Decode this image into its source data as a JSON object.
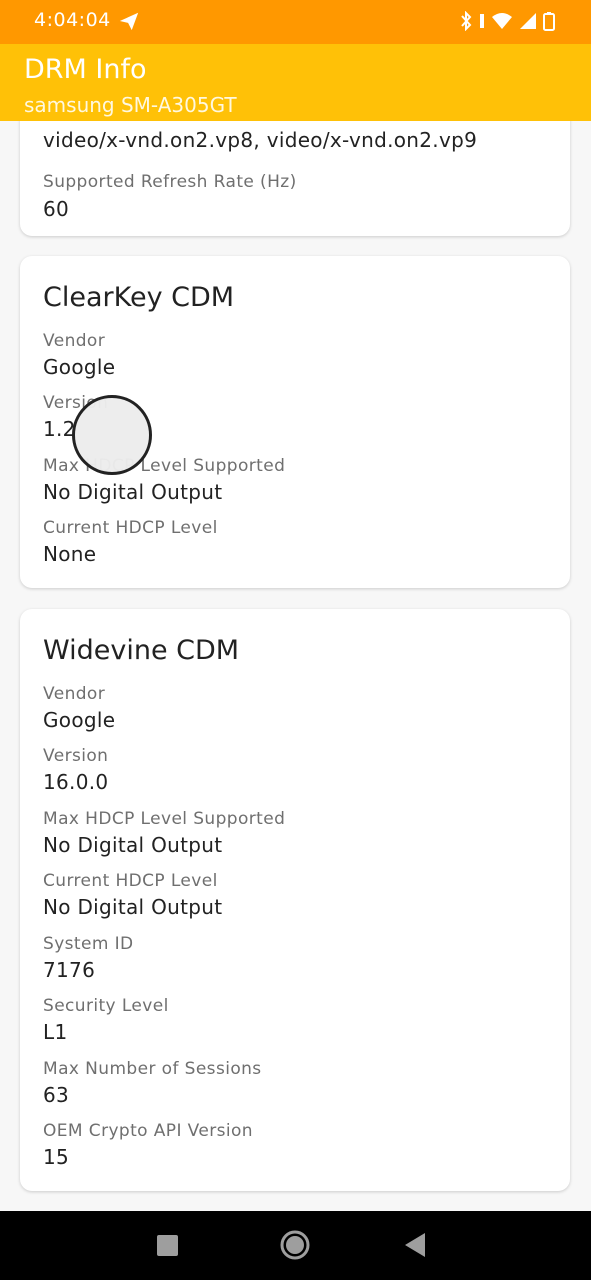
{
  "status_bar": {
    "time": "4:04:04",
    "icons": [
      "send-icon",
      "bluetooth-icon",
      "wifi-icon",
      "signal-icon",
      "battery-icon"
    ]
  },
  "app_bar": {
    "title": "DRM Info",
    "subtitle": "samsung SM-A305GT",
    "color": "#ffc107",
    "status_color": "#ff9800"
  },
  "top_card": {
    "partial_value": "video/x-vnd.on2.vp8, video/x-vnd.on2.vp9",
    "fields": [
      {
        "label": "Supported Refresh Rate (Hz)",
        "value": "60"
      }
    ]
  },
  "clearkey": {
    "title": "ClearKey CDM",
    "fields": [
      {
        "label": "Vendor",
        "value": "Google"
      },
      {
        "label": "Version",
        "value": "1.2"
      },
      {
        "label": "Max HDCP Level Supported",
        "value": "No Digital Output"
      },
      {
        "label": "Current HDCP Level",
        "value": "None"
      }
    ]
  },
  "widevine": {
    "title": "Widevine CDM",
    "fields": [
      {
        "label": "Vendor",
        "value": "Google"
      },
      {
        "label": "Version",
        "value": "16.0.0"
      },
      {
        "label": "Max HDCP Level Supported",
        "value": "No Digital Output"
      },
      {
        "label": "Current HDCP Level",
        "value": "No Digital Output"
      },
      {
        "label": "System ID",
        "value": "7176"
      },
      {
        "label": "Security Level",
        "value": "L1"
      },
      {
        "label": "Max Number of Sessions",
        "value": "63"
      },
      {
        "label": "OEM Crypto API Version",
        "value": "15"
      }
    ]
  },
  "nav_bar": {
    "buttons": [
      "recents-icon",
      "home-icon",
      "back-icon"
    ]
  }
}
